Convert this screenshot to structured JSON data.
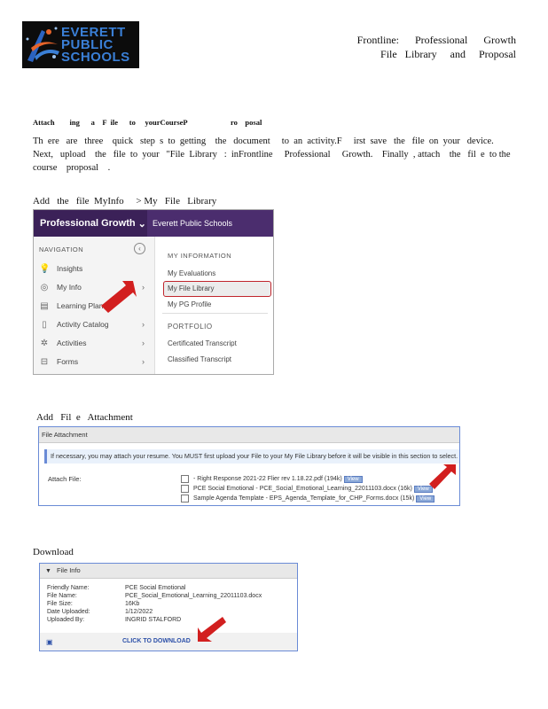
{
  "logo": {
    "line1": "EVERETT",
    "line2": "PUBLIC",
    "line3": "SCHOOLS"
  },
  "header": {
    "line1": "Frontline:      Professional      Growth",
    "line2": "File   Library     and     Proposal"
  },
  "title": "Attach        ing      a    F  ile      to     yourCourseP                       ro    posal",
  "paragraph": {
    "line1": "Th  ere   are   three    quick   step  s  to  getting    the   document     to  an  activity.F     irst  save   the   file  on  your   device.",
    "line2": "Next,   upload    the   file  to  your   \"File  Library   :  inFrontline     Professional     Growth.    Finally  , attach    the   fil  e  to the",
    "line3": "course    proposal    ."
  },
  "section1_label": "Add   the   file  MyInfo     > My   File   Library",
  "nav": {
    "app_title": "Professional Growth",
    "org": "Everett Public Schools",
    "nav_header": "NAVIGATION",
    "items": [
      "Insights",
      "My Info",
      "Learning Plan",
      "Activity Catalog",
      "Activities",
      "Forms"
    ],
    "right_header1": "MY INFORMATION",
    "right_links": [
      "My Evaluations",
      "My File Library",
      "My PG Profile"
    ],
    "right_header2": "PORTFOLIO",
    "portfolio_links": [
      "Certificated Transcript",
      "Classified Transcript"
    ]
  },
  "section2_label": "Add   Fil  e   Attachment",
  "file_attachment": {
    "title": "File Attachment",
    "note": "If necessary, you may attach your resume. You MUST first upload your File to your My File Library before it will be visible in this section to select.",
    "attach_label": "Attach File:",
    "files": [
      "- Right  Response  2021-22  Flier  rev  1.18.22.pdf (194k)",
      "PCE Social Emotional - PCE_Social_Emotional_Learning_22011103.docx (16k)",
      "Sample Agenda Template - EPS_Agenda_Template_for_CHP_Forms.docx (15k)"
    ],
    "view_label": "View"
  },
  "section3_label": "Download",
  "file_info": {
    "title": "File Info",
    "rows": [
      {
        "k": "Friendly Name:",
        "v": "PCE Social Emotional"
      },
      {
        "k": "File Name:",
        "v": "PCE_Social_Emotional_Learning_22011103.docx"
      },
      {
        "k": "File Size:",
        "v": "16Kb"
      },
      {
        "k": "Date Uploaded:",
        "v": "1/12/2022"
      },
      {
        "k": "Uploaded By:",
        "v": "INGRID STALFORD"
      }
    ],
    "download_label": "CLICK TO DOWNLOAD"
  },
  "colors": {
    "nav_purple": "#4b2d6e",
    "arrow_red": "#d21f1f",
    "highlight_red": "#c0262d",
    "logo_blue": "#3a7fd6"
  }
}
